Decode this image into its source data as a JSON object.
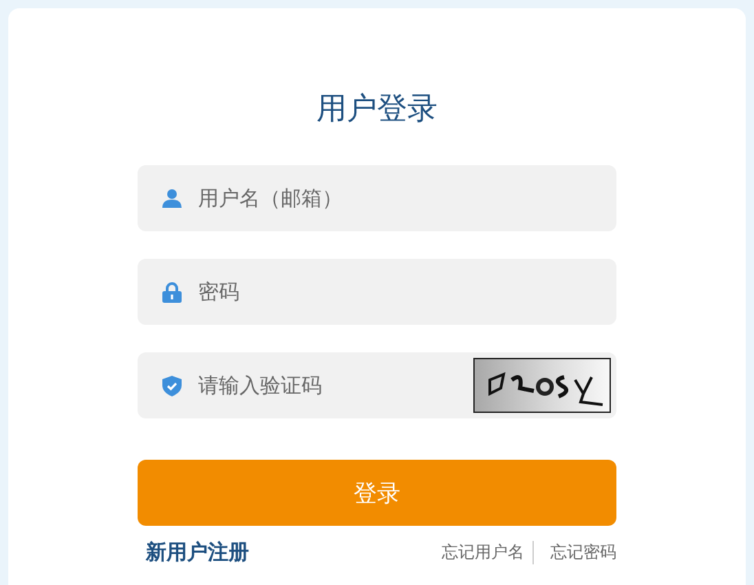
{
  "title": "用户登录",
  "fields": [
    {
      "kind": "user",
      "placeholder": "用户名（邮箱）"
    },
    {
      "kind": "password",
      "placeholder": "密码"
    },
    {
      "kind": "captcha",
      "placeholder": "请输入验证码"
    }
  ],
  "captcha": {
    "kind": "picture"
  },
  "submit": "登录",
  "register": "新用户注册",
  "links": [
    "忘记用户名",
    "忘记密码"
  ]
}
